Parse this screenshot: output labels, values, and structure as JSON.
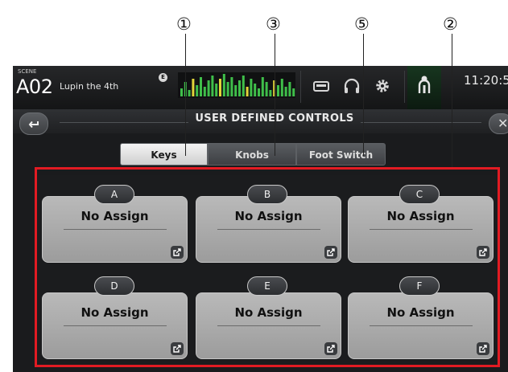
{
  "callouts": [
    {
      "number": "①"
    },
    {
      "number": "③"
    },
    {
      "number": "⑤"
    },
    {
      "number": "②"
    }
  ],
  "header": {
    "scene_label": "SCENE",
    "scene_number": "A02",
    "scene_name": "Lupin the 4th",
    "scene_badge": "E",
    "time": "11:20:5"
  },
  "toolbar": {
    "icons": [
      "recorder-icon",
      "headphones-icon",
      "gear-icon",
      "user-icon"
    ],
    "active_icon": "user-icon"
  },
  "page": {
    "title": "USER DEFINED CONTROLS",
    "back_icon": "back-arrow-icon",
    "close_icon": "close-icon"
  },
  "tabs": [
    {
      "label": "Keys",
      "active": true
    },
    {
      "label": "Knobs",
      "active": false
    },
    {
      "label": "Foot Switch",
      "active": false
    }
  ],
  "keys": [
    {
      "id": "A",
      "value": "No Assign"
    },
    {
      "id": "B",
      "value": "No Assign"
    },
    {
      "id": "C",
      "value": "No Assign"
    },
    {
      "id": "D",
      "value": "No Assign"
    },
    {
      "id": "E",
      "value": "No Assign"
    },
    {
      "id": "F",
      "value": "No Assign"
    }
  ],
  "colors": {
    "callout_frame": "#e21b23",
    "active_tab": "#e8e8e8",
    "key_card": "#acacac"
  }
}
